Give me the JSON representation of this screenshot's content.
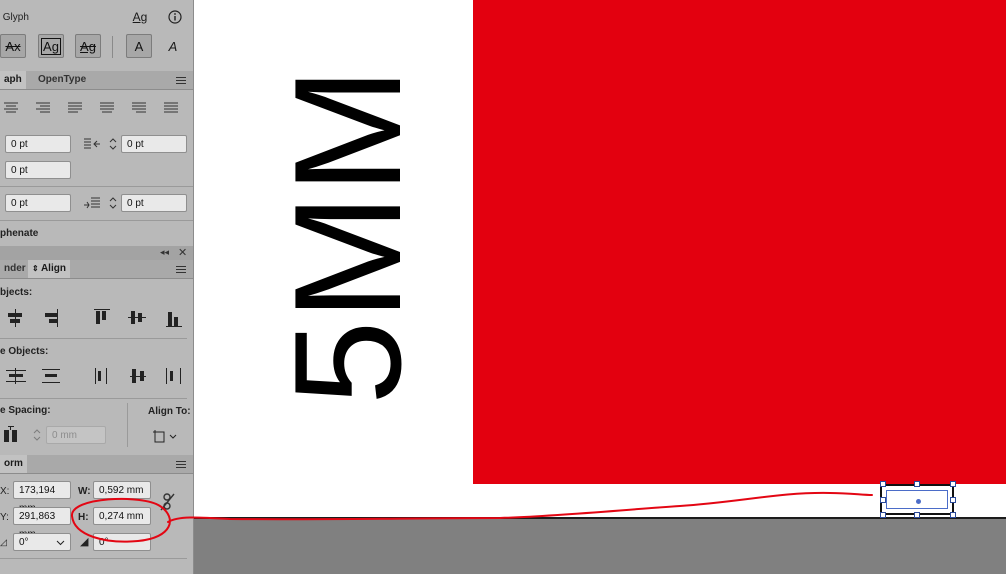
{
  "glyph_panel": {
    "title": " Glyph",
    "buttons": [
      "Ax",
      "Ag",
      "Ag",
      "A",
      "A"
    ]
  },
  "paragraph_panel": {
    "tabs": [
      "aph",
      "OpenType"
    ],
    "space_before": "0 pt",
    "space_after": "0 pt",
    "left_indent": "0 pt",
    "first_indent": "0 pt",
    "bottom_left": "0 pt",
    "bottom_right": "0 pt",
    "hyphenate_label": "phenate"
  },
  "align_panel": {
    "tabs": [
      "nder",
      "Align"
    ],
    "align_objects_label": "bjects:",
    "distribute_objects_label": "e Objects:",
    "distribute_spacing_label": "e Spacing:",
    "spacing_value": "0 mm",
    "align_to_label": "Align To:"
  },
  "transform_panel": {
    "title": "orm",
    "x_label": "X:",
    "x_value": "173,194 mm",
    "y_label": "Y:",
    "y_value": "291,863 mm",
    "w_label": "W:",
    "w_value": "0,592 mm",
    "h_label": "H:",
    "h_value": "0,274 mm",
    "rotate_value": "0°",
    "shear_value": "0°"
  },
  "canvas": {
    "text": "5MM",
    "colors": {
      "red_block": "#e3000f",
      "page": "#ffffff",
      "pasteboard": "#808080",
      "annotation": "#e30613"
    }
  }
}
